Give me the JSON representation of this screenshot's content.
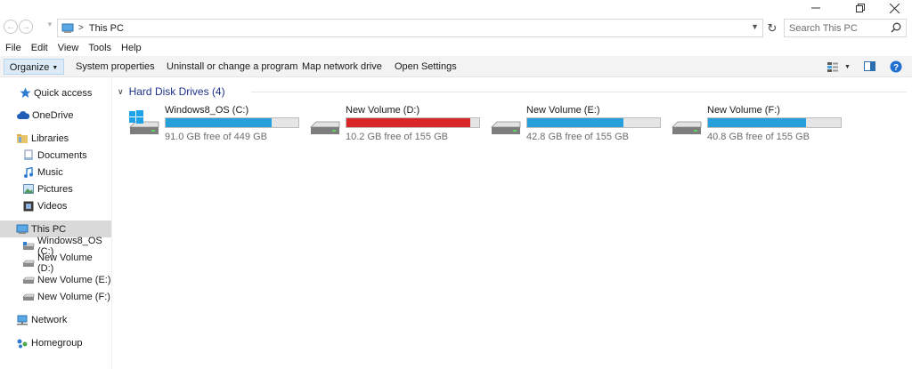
{
  "window": {
    "minimize": "—",
    "maximize": "❐",
    "close": "✕"
  },
  "address": {
    "path": "This PC",
    "search_placeholder": "Search This PC"
  },
  "menu": [
    "File",
    "Edit",
    "View",
    "Tools",
    "Help"
  ],
  "toolbar": {
    "organize": "Organize",
    "system_properties": "System properties",
    "uninstall": "Uninstall or change a program",
    "map_drive": "Map network drive",
    "open_settings": "Open Settings"
  },
  "sidebar": {
    "items": [
      {
        "label": "Quick access",
        "icon": "star-icon"
      },
      {
        "label": "OneDrive",
        "icon": "cloud-icon"
      },
      {
        "label": "Libraries",
        "icon": "folder-icon"
      },
      {
        "label": "Documents",
        "icon": "documents-icon"
      },
      {
        "label": "Music",
        "icon": "music-icon"
      },
      {
        "label": "Pictures",
        "icon": "pictures-icon"
      },
      {
        "label": "Videos",
        "icon": "videos-icon"
      },
      {
        "label": "This PC",
        "icon": "computer-icon"
      },
      {
        "label": "Windows8_OS (C:)",
        "icon": "system-drive-icon"
      },
      {
        "label": "New Volume (D:)",
        "icon": "drive-icon"
      },
      {
        "label": "New Volume (E:)",
        "icon": "drive-icon"
      },
      {
        "label": "New Volume (F:)",
        "icon": "drive-icon"
      },
      {
        "label": "Network",
        "icon": "network-icon"
      },
      {
        "label": "Homegroup",
        "icon": "homegroup-icon"
      }
    ]
  },
  "content": {
    "group_title": "Hard Disk Drives (4)",
    "drives": [
      {
        "name": "Windows8_OS (C:)",
        "free": "91.0 GB free of 449 GB",
        "used_fraction": 0.797,
        "bar_color": "#26a0da",
        "system": true
      },
      {
        "name": "New Volume (D:)",
        "free": "10.2 GB free of 155 GB",
        "used_fraction": 0.934,
        "bar_color": "#da2626",
        "system": false
      },
      {
        "name": "New Volume (E:)",
        "free": "42.8 GB free of 155 GB",
        "used_fraction": 0.724,
        "bar_color": "#26a0da",
        "system": false
      },
      {
        "name": "New Volume (F:)",
        "free": "40.8 GB free of 155 GB",
        "used_fraction": 0.737,
        "bar_color": "#26a0da",
        "system": false
      }
    ]
  },
  "colors": {
    "accent": "#26a0da",
    "warning": "#da2626",
    "group_title": "#1e3287",
    "selection": "#d9d9d9",
    "organize_bg": "#dcebf7"
  }
}
